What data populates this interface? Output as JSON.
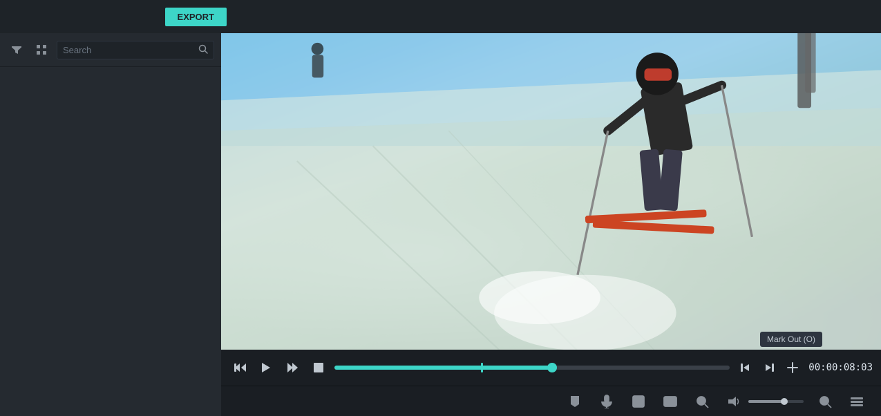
{
  "header": {
    "export_label": "EXPORT"
  },
  "left_panel": {
    "search_placeholder": "Search",
    "filter_icon": "filter",
    "grid_icon": "grid",
    "search_icon": "search"
  },
  "video_controls": {
    "time_display": "00:00:08:03",
    "progress_percent": 55,
    "mark_out_tooltip": "Mark Out (O)",
    "buttons": {
      "skip_back": "⏮",
      "play": "▶",
      "play_alt": "▶",
      "stop": "■"
    }
  },
  "bottom_toolbar": {
    "icons": [
      "marker",
      "mic",
      "script",
      "pip",
      "zoom-out",
      "zoom-in",
      "add",
      "more"
    ]
  }
}
